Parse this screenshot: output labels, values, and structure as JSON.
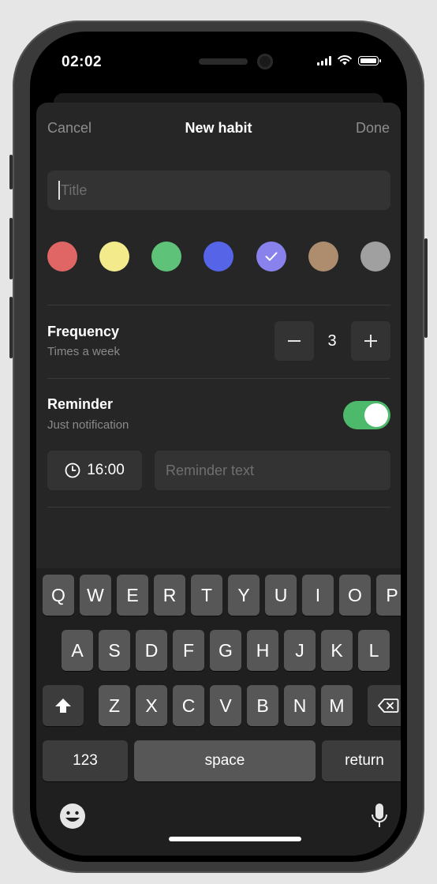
{
  "status_bar": {
    "time": "02:02"
  },
  "nav": {
    "cancel_label": "Cancel",
    "title": "New habit",
    "done_label": "Done"
  },
  "title_field": {
    "placeholder": "Title",
    "value": ""
  },
  "colors": [
    {
      "name": "red",
      "hex": "#e06565",
      "selected": false
    },
    {
      "name": "yellow",
      "hex": "#f3ea8c",
      "selected": false
    },
    {
      "name": "green",
      "hex": "#5ec379",
      "selected": false
    },
    {
      "name": "blue",
      "hex": "#5664e7",
      "selected": false
    },
    {
      "name": "purple",
      "hex": "#8982ec",
      "selected": true
    },
    {
      "name": "brown",
      "hex": "#ae8d6e",
      "selected": false
    },
    {
      "name": "gray",
      "hex": "#a0a0a0",
      "selected": false
    }
  ],
  "frequency": {
    "title": "Frequency",
    "subtitle": "Times a week",
    "value": "3",
    "decrement_icon": "minus-icon",
    "increment_icon": "plus-icon"
  },
  "reminder": {
    "title": "Reminder",
    "subtitle": "Just notification",
    "enabled": true,
    "time": "16:00",
    "text_placeholder": "Reminder text",
    "text_value": ""
  },
  "keyboard": {
    "row1": [
      "Q",
      "W",
      "E",
      "R",
      "T",
      "Y",
      "U",
      "I",
      "O",
      "P"
    ],
    "row2": [
      "A",
      "S",
      "D",
      "F",
      "G",
      "H",
      "J",
      "K",
      "L"
    ],
    "row3": [
      "Z",
      "X",
      "C",
      "V",
      "B",
      "N",
      "M"
    ],
    "numbers_label": "123",
    "space_label": "space",
    "return_label": "return",
    "shift_icon": "shift-icon",
    "delete_icon": "backspace-icon",
    "emoji_icon": "emoji-icon",
    "mic_icon": "microphone-icon"
  },
  "theme": {
    "accent_green": "#4cba6a",
    "background": "#262626",
    "field": "#333333"
  }
}
